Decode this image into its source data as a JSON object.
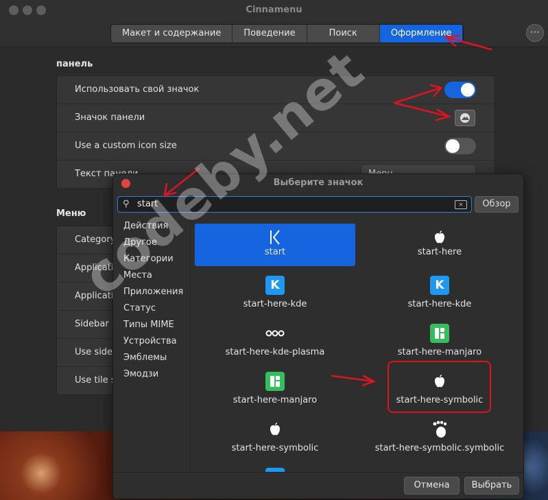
{
  "window": {
    "title": "Cinnamenu"
  },
  "tabs": [
    {
      "label": "Макет и содержание"
    },
    {
      "label": "Поведение"
    },
    {
      "label": "Поиск"
    },
    {
      "label": "Оформление",
      "active": true
    }
  ],
  "panel_section": {
    "heading": "панель",
    "rows": [
      {
        "label": "Использовать свой значок",
        "control": "switch",
        "on": true
      },
      {
        "label": "Значок панели",
        "control": "icon-button"
      },
      {
        "label": "Use a custom icon size",
        "control": "switch",
        "on": false
      },
      {
        "label": "Текст панели",
        "control": "combo",
        "value": "Menu"
      }
    ]
  },
  "menu_section": {
    "heading": "Меню",
    "rows": [
      {
        "label": "Category"
      },
      {
        "label": "Applicati"
      },
      {
        "label": "Applicati"
      },
      {
        "label": "Sidebar ic"
      },
      {
        "label": "Use sideb"
      },
      {
        "label": "Use tile s"
      }
    ]
  },
  "dialog": {
    "title": "Выберите значок",
    "search_value": "start",
    "browse_label": "Обзор",
    "categories": [
      "Действия",
      "Другое",
      "Категории",
      "Места",
      "Приложения",
      "Статус",
      "Типы MIME",
      "Устройства",
      "Эмблемы",
      "Эмодзи"
    ],
    "icons": [
      {
        "name": "start",
        "icon": "start-icon",
        "selected": true
      },
      {
        "name": "start-here",
        "icon": "apple-icon"
      },
      {
        "name": "start-here-kde",
        "icon": "kde-icon"
      },
      {
        "name": "start-here-kde",
        "icon": "kde-icon"
      },
      {
        "name": "start-here-kde-plasma",
        "icon": "plasma-dots-icon"
      },
      {
        "name": "start-here-manjaro",
        "icon": "manjaro-icon"
      },
      {
        "name": "start-here-manjaro",
        "icon": "manjaro-icon"
      },
      {
        "name": "start-here-symbolic",
        "icon": "apple-icon",
        "highlighted": true
      },
      {
        "name": "start-here-symbolic",
        "icon": "apple-icon"
      },
      {
        "name": "start-here-symbolic.symbolic",
        "icon": "gnome-foot-icon"
      }
    ],
    "cancel_label": "Отмена",
    "select_label": "Выбрать"
  },
  "watermark": "codeby.net",
  "colors": {
    "accent": "#1565e0",
    "annotation": "#e0141e"
  }
}
